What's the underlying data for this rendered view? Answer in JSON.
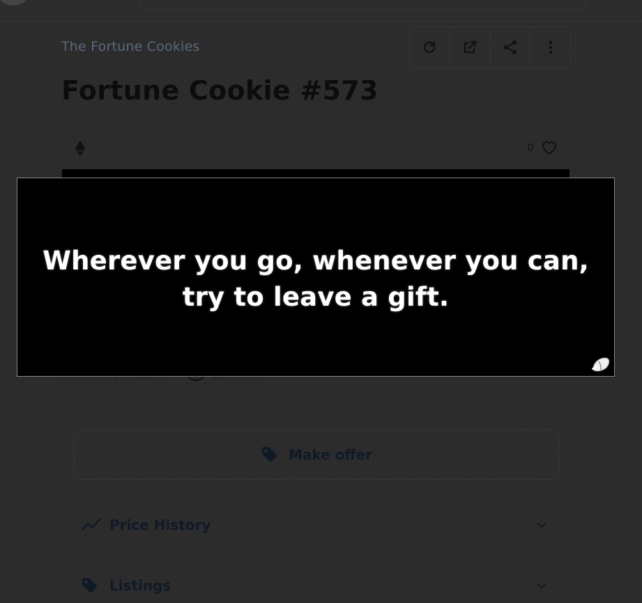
{
  "collection": {
    "name": "The Fortune Cookies"
  },
  "item": {
    "title": "Fortune Cookie #573",
    "likes": "0"
  },
  "owner": {
    "text": "Owned by baabiz",
    "views": "12 views"
  },
  "modal": {
    "fortune_line1": "Wherever you go, whenever you can,",
    "fortune_line2": "try to leave a gift."
  },
  "actions": {
    "icons": [
      "refresh-icon",
      "external-link-icon",
      "share-icon",
      "more-vertical-icon"
    ]
  },
  "offer": {
    "label": "Make offer"
  },
  "sections": [
    {
      "label": "Price History",
      "icon": "trend-line-icon"
    },
    {
      "label": "Listings",
      "icon": "tag-icon"
    }
  ],
  "colors": {
    "backdrop": "#2c2c2c",
    "modal_bg": "#000000",
    "fortune_text": "#ffffff"
  }
}
